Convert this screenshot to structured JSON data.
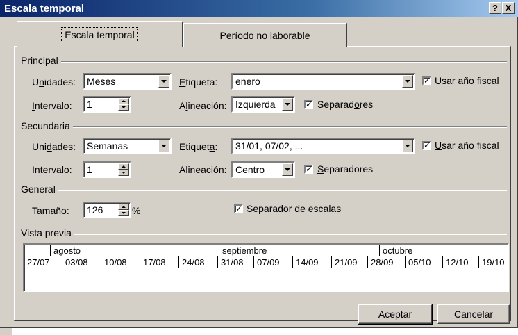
{
  "window": {
    "title": "Escala temporal",
    "help_label": "?",
    "close_label": "X"
  },
  "tabs": [
    {
      "label": "Escala temporal",
      "active": true
    },
    {
      "label": "Período no laborable",
      "active": false
    }
  ],
  "principal": {
    "section_title": "Principal",
    "units_label_pre": "U",
    "units_label_key": "n",
    "units_label_post": "idades:",
    "units_value": "Meses",
    "interval_label_key": "I",
    "interval_label_post": "ntervalo:",
    "interval_value": "1",
    "label_label_key": "E",
    "label_label_post": "tiqueta:",
    "label_value": "enero",
    "align_label_pre": "A",
    "align_label_key": "l",
    "align_label_post": "ineación:",
    "align_value": "Izquierda",
    "fiscal_checked": true,
    "fiscal_label_pre": "Usar año ",
    "fiscal_label_key": "f",
    "fiscal_label_post": "iscal",
    "separators_checked": true,
    "separators_label_pre": "Separad",
    "separators_label_key": "o",
    "separators_label_post": "res"
  },
  "secundaria": {
    "section_title": "Secundaria",
    "units_label_pre": "Uni",
    "units_label_key": "d",
    "units_label_post": "ades:",
    "units_value": "Semanas",
    "interval_label_pre": "In",
    "interval_label_key": "t",
    "interval_label_post": "ervalo:",
    "interval_value": "1",
    "label_label_pre": "Etiquet",
    "label_label_key": "a",
    "label_label_post": ":",
    "label_value": "31/01, 07/02, ...",
    "align_label_pre": "Alinea",
    "align_label_key": "c",
    "align_label_post": "ión:",
    "align_value": "Centro",
    "fiscal_checked": true,
    "fiscal_label_key": "U",
    "fiscal_label_post": "sar año fiscal",
    "separators_checked": true,
    "separators_label_key": "S",
    "separators_label_post": "eparadores"
  },
  "general": {
    "section_title": "General",
    "size_label_pre": "Ta",
    "size_label_key": "m",
    "size_label_post": "año:",
    "size_value": "126",
    "size_unit": "%",
    "scale_sep_checked": true,
    "scale_sep_label_pre": "Separado",
    "scale_sep_label_key": "r",
    "scale_sep_label_post": " de escalas"
  },
  "preview": {
    "section_title": "Vista previa",
    "months": [
      "agosto",
      "septiembre",
      "octubre"
    ],
    "weeks": [
      "27/07",
      "03/08",
      "10/08",
      "17/08",
      "24/08",
      "31/08",
      "07/09",
      "14/09",
      "21/09",
      "28/09",
      "05/10",
      "12/10",
      "19/10"
    ]
  },
  "buttons": {
    "ok": "Aceptar",
    "cancel": "Cancelar"
  },
  "check_mark": "✓"
}
